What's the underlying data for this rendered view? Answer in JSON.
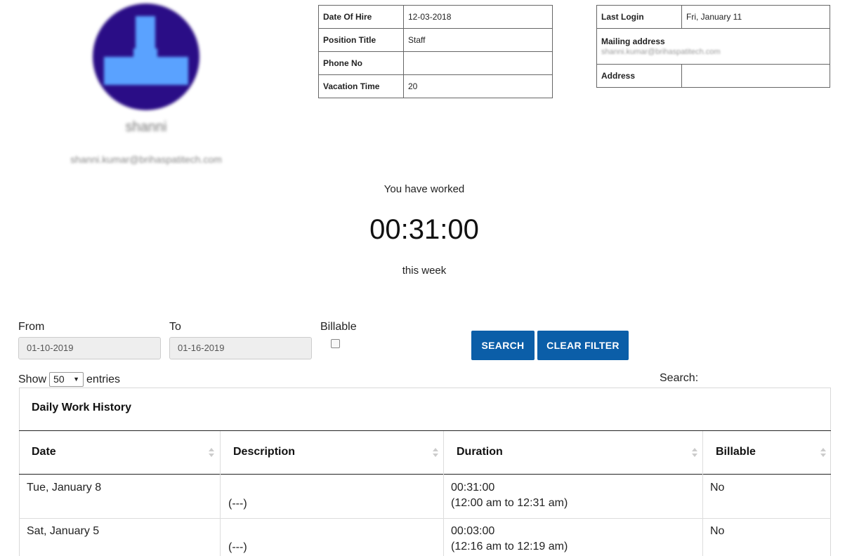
{
  "profile": {
    "name": "shanni",
    "email": "shanni.kumar@brihaspatitech.com"
  },
  "employment": [
    {
      "label": "Date Of Hire",
      "value": "12-03-2018"
    },
    {
      "label": "Position Title",
      "value": "Staff"
    },
    {
      "label": "Phone No",
      "value": ""
    },
    {
      "label": "Vacation Time",
      "value": "20"
    }
  ],
  "contact": {
    "last_login_label": "Last Login",
    "last_login_value": "Fri, January 11",
    "mailing_label": "Mailing address",
    "mailing_value": "shanni.kumar@brihaspatitech.com",
    "address_label": "Address",
    "address_value": ""
  },
  "summary": {
    "prefix": "You have worked",
    "time": "00:31:00",
    "suffix": "this week"
  },
  "filters": {
    "from_label": "From",
    "from_value": "01-10-2019",
    "to_label": "To",
    "to_value": "01-16-2019",
    "billable_label": "Billable",
    "billable_checked": false,
    "search_button": "SEARCH",
    "clear_button": "CLEAR FILTER"
  },
  "table_controls": {
    "show_label": "Show",
    "entries_value": "50",
    "entries_label": "entries",
    "search_label": "Search:"
  },
  "history": {
    "title": "Daily Work History",
    "columns": [
      "Date",
      "Description",
      "Duration",
      "Billable"
    ],
    "rows": [
      {
        "date": "Tue, January 8",
        "description": "(---)",
        "duration": "00:31:00",
        "range": "(12:00 am to 12:31 am)",
        "billable": "No"
      },
      {
        "date": "Sat, January 5",
        "description": "(---)",
        "duration": "00:03:00",
        "range": "(12:16 am to 12:19 am)",
        "billable": "No"
      }
    ]
  },
  "colors": {
    "accent": "#0b5ea8",
    "avatar_bg": "#2a0d86",
    "avatar_fg": "#5aa2ff"
  }
}
